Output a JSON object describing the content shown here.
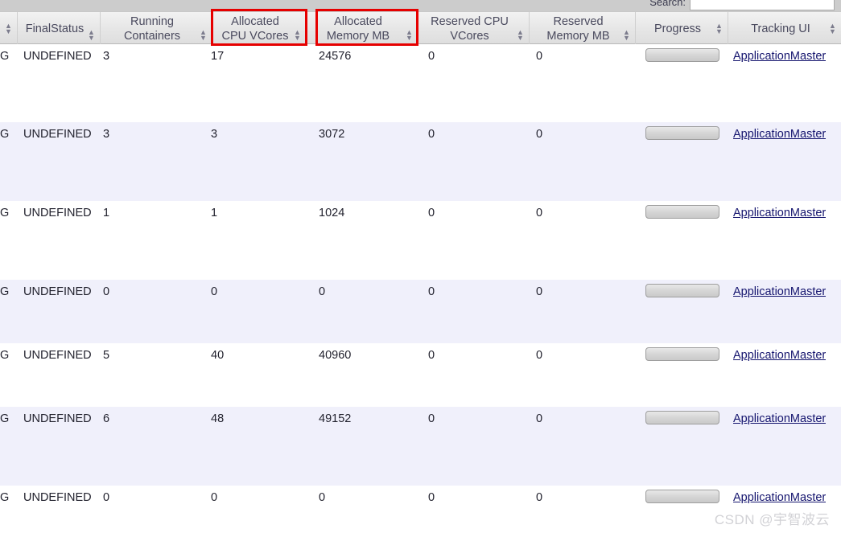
{
  "toolbar": {
    "search_label": "Search:",
    "search_value": "",
    "search_placeholder": ""
  },
  "table": {
    "columns": [
      {
        "label": "",
        "sortable": true,
        "clipped": true
      },
      {
        "label": "FinalStatus",
        "sortable": true
      },
      {
        "label": "Running Containers",
        "sortable": true
      },
      {
        "label": "Allocated CPU VCores",
        "sortable": true,
        "highlighted": true
      },
      {
        "label": "Allocated Memory MB",
        "sortable": true,
        "highlighted": true
      },
      {
        "label": "Reserved CPU VCores",
        "sortable": true
      },
      {
        "label": "Reserved Memory MB",
        "sortable": true
      },
      {
        "label": "Progress",
        "sortable": true
      },
      {
        "label": "Tracking UI",
        "sortable": true
      }
    ],
    "rows": [
      {
        "state_clipped": "IG",
        "final_status": "UNDEFINED",
        "running_containers": "3",
        "allocated_cpu_vcores": "17",
        "allocated_memory_mb": "24576",
        "reserved_cpu_vcores": "0",
        "reserved_memory_mb": "0",
        "progress": "0",
        "tracking_ui": "ApplicationMaster"
      },
      {
        "state_clipped": "IG",
        "final_status": "UNDEFINED",
        "running_containers": "3",
        "allocated_cpu_vcores": "3",
        "allocated_memory_mb": "3072",
        "reserved_cpu_vcores": "0",
        "reserved_memory_mb": "0",
        "progress": "0",
        "tracking_ui": "ApplicationMaster"
      },
      {
        "state_clipped": "IG",
        "final_status": "UNDEFINED",
        "running_containers": "1",
        "allocated_cpu_vcores": "1",
        "allocated_memory_mb": "1024",
        "reserved_cpu_vcores": "0",
        "reserved_memory_mb": "0",
        "progress": "0",
        "tracking_ui": "ApplicationMaster"
      },
      {
        "state_clipped": "IG",
        "final_status": "UNDEFINED",
        "running_containers": "0",
        "allocated_cpu_vcores": "0",
        "allocated_memory_mb": "0",
        "reserved_cpu_vcores": "0",
        "reserved_memory_mb": "0",
        "progress": "0",
        "tracking_ui": "ApplicationMaster"
      },
      {
        "state_clipped": "IG",
        "final_status": "UNDEFINED",
        "running_containers": "5",
        "allocated_cpu_vcores": "40",
        "allocated_memory_mb": "40960",
        "reserved_cpu_vcores": "0",
        "reserved_memory_mb": "0",
        "progress": "0",
        "tracking_ui": "ApplicationMaster"
      },
      {
        "state_clipped": "IG",
        "final_status": "UNDEFINED",
        "running_containers": "6",
        "allocated_cpu_vcores": "48",
        "allocated_memory_mb": "49152",
        "reserved_cpu_vcores": "0",
        "reserved_memory_mb": "0",
        "progress": "0",
        "tracking_ui": "ApplicationMaster"
      },
      {
        "state_clipped": "IG",
        "final_status": "UNDEFINED",
        "running_containers": "0",
        "allocated_cpu_vcores": "0",
        "allocated_memory_mb": "0",
        "reserved_cpu_vcores": "0",
        "reserved_memory_mb": "0",
        "progress": "0",
        "tracking_ui": "ApplicationMaster"
      }
    ]
  },
  "annotations": {
    "highlight_color": "#e60000",
    "boxes": [
      {
        "target": "Allocated CPU VCores"
      },
      {
        "target": "Allocated Memory MB"
      }
    ]
  },
  "watermark": {
    "text": "CSDN @宇智波云"
  }
}
